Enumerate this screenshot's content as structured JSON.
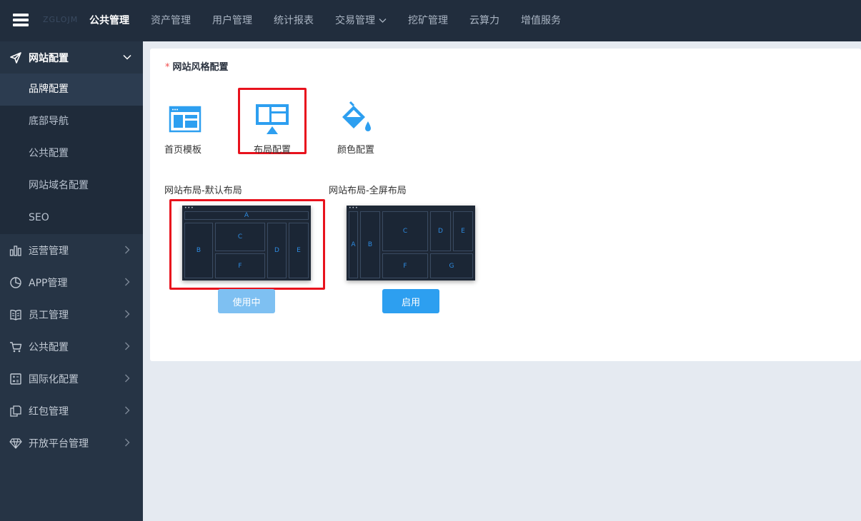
{
  "brand": {
    "logo_text": "ZGLOJM",
    "logo_icon": "server-stack-icon"
  },
  "topnav": {
    "items": [
      {
        "label": "公共管理",
        "active": true
      },
      {
        "label": "资产管理"
      },
      {
        "label": "用户管理"
      },
      {
        "label": "统计报表"
      },
      {
        "label": "交易管理",
        "has_dropdown": true
      },
      {
        "label": "挖矿管理"
      },
      {
        "label": "云算力"
      },
      {
        "label": "增值服务"
      }
    ]
  },
  "sidebar": {
    "groups": [
      {
        "label": "网站配置",
        "icon": "paper-plane-icon",
        "open": true,
        "children": [
          {
            "label": "品牌配置",
            "active": true
          },
          {
            "label": "底部导航"
          },
          {
            "label": "公共配置"
          },
          {
            "label": "网站域名配置"
          },
          {
            "label": "SEO"
          }
        ]
      },
      {
        "label": "运营管理",
        "icon": "bar-chart-icon"
      },
      {
        "label": "APP管理",
        "icon": "pie-chart-icon"
      },
      {
        "label": "员工管理",
        "icon": "book-icon"
      },
      {
        "label": "公共配置",
        "icon": "cart-icon"
      },
      {
        "label": "国际化配置",
        "icon": "calculator-icon"
      },
      {
        "label": "红包管理",
        "icon": "copy-icon"
      },
      {
        "label": "开放平台管理",
        "icon": "diamond-icon"
      }
    ]
  },
  "main": {
    "section_title": "网站风格配置",
    "required_mark": "*",
    "tiles": [
      {
        "label": "首页模板",
        "icon": "homepage-template-icon"
      },
      {
        "label": "布局配置",
        "icon": "layout-monitor-icon",
        "selected": true
      },
      {
        "label": "颜色配置",
        "icon": "paint-bucket-icon"
      }
    ],
    "layouts": [
      {
        "title": "网站布局-默认布局",
        "button": "使用中",
        "in_use": true,
        "blocks": [
          "A",
          "B",
          "C",
          "D",
          "E",
          "F"
        ]
      },
      {
        "title": "网站布局-全屏布局",
        "button": "启用",
        "in_use": false,
        "blocks": [
          "A",
          "B",
          "C",
          "D",
          "E",
          "F",
          "G"
        ]
      }
    ]
  },
  "colors": {
    "topbar": "#212d3d",
    "sidebar": "#263445",
    "accent": "#2d9ff0",
    "highlight": "#e8121d",
    "required": "#f04b4b"
  }
}
